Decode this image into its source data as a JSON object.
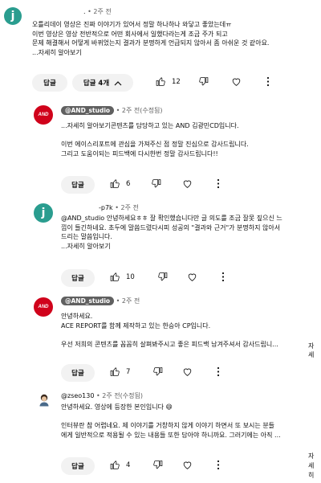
{
  "comments": [
    {
      "avatar_letter": "j",
      "username": ".",
      "time": "2주 전",
      "lines": [
        "오틀리데이 영상은 진짜 이야기가 있어서 정말 하나하나 와닿고 좋았는데ㅠ",
        "이번 영상은 영상 전반적으로 어떤 회사에서 일했다라는게 조금 주가 되고",
        "문제 해결해서 어떻게 바뀌었는지 결과가 분명하게 언급되지 않아서 좀 아쉬운 것 같아요."
      ],
      "more": "...자세히 알아보기",
      "reply_label": "답글",
      "replies_label": "답글 4개",
      "likes": "12"
    },
    {
      "avatar_text": "AND",
      "username": "@AND_studio",
      "time": "2주 전(수정됨)",
      "lines": [
        "...자세히 알아보기",
        "",
        "이번 에이스리포트에 관심을 가져주신 점 정말 진심으로 감사드립니다.",
        "그리고 도움이되는 피드백에 다시한번 정말 감사드립니다!!"
      ],
      "first_line_suffix": "콘텐츠를 담당하고 있는 AND 김광민CD입니다.",
      "reply_label": "답글",
      "likes": "6"
    },
    {
      "avatar_letter": "j",
      "username": "-p7k",
      "time": "2주 전",
      "lines": [
        "@AND_studio 안녕하세요ㅎㅎ 잘 확인했습니다만 글 의도를 조금 잘못 짚으신 느",
        "낌이 들긴하네요. 초두에 말씀드렸다시피 성공의 \"결과와 근거\"가 분명하지 않아서",
        "드리는 말씀입니다."
      ],
      "more": "...자세히 알아보기",
      "reply_label": "답글",
      "likes": "10"
    },
    {
      "avatar_text": "AND",
      "username": "@AND_studio",
      "time": "2주 전",
      "lines": [
        "안녕하세요.",
        "ACE REPORT를 함께 제작하고 있는 한승아 CP입니다.",
        "",
        "우선 저희의 콘텐츠를 꼼꼼히 살펴봐주시고 좋은 피드백 남겨주셔서 감사드립니..."
      ],
      "cut": "자\n세",
      "reply_label": "답글",
      "likes": "7"
    },
    {
      "username": "@zseo130",
      "time": "2주 전(수정됨)",
      "lines": [
        "안녕하세요. 영상에 등장한 본인입니다 😄",
        "",
        "인터뷰란 참 어렵네요. 제 이야기를 거창하지 않게 이야기 하면서 또 보시는 분들",
        "에게 일반적으로 적용될 수 있는 내용들 또한 담아야 하니까요. 그러기에는 아직 ..."
      ],
      "cut": "자\n세\n히",
      "reply_label": "답글",
      "likes": "4"
    }
  ],
  "icons": {
    "like": "thumb-up-icon",
    "dislike": "thumb-down-icon",
    "heart": "heart-icon",
    "more": "more-vert-icon",
    "chevron": "chevron-up-icon"
  },
  "colors": {
    "avatar_j": "#2a9d8f",
    "avatar_and": "#d0021b",
    "pill_bg": "#f2f2f2",
    "meta": "#606060"
  }
}
